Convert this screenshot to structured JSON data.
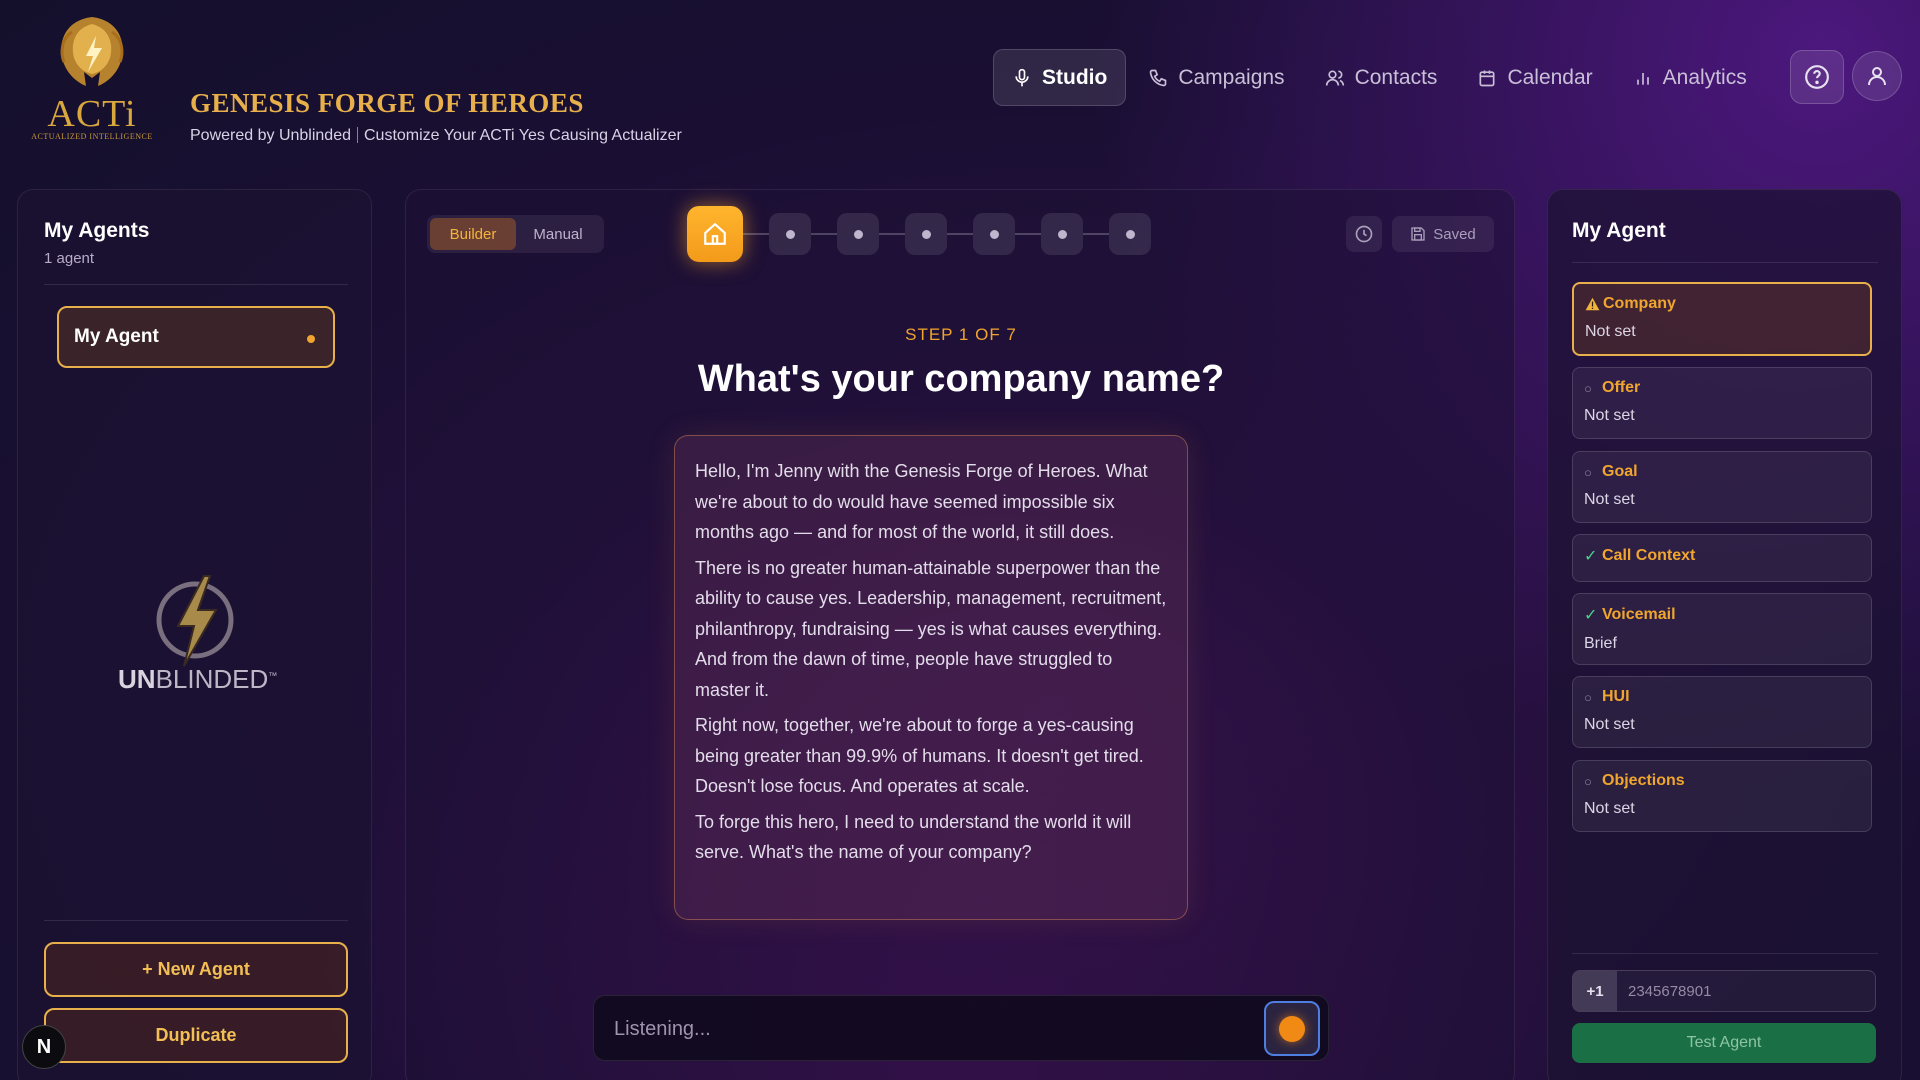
{
  "brand": {
    "logo_text": "ACTi",
    "logo_sub": "ACTUALIZED INTELLIGENCE",
    "title": "GENESIS FORGE OF HEROES",
    "subtitle_left": "Powered by Unblinded",
    "subtitle_right": "Customize Your ACTi Yes Causing Actualizer"
  },
  "nav": {
    "items": [
      {
        "label": "Studio",
        "icon": "mic-icon",
        "active": true
      },
      {
        "label": "Campaigns",
        "icon": "phone-icon"
      },
      {
        "label": "Contacts",
        "icon": "users-icon"
      },
      {
        "label": "Calendar",
        "icon": "calendar-icon"
      },
      {
        "label": "Analytics",
        "icon": "bar-chart-icon"
      }
    ],
    "help_icon": "help-circle-icon",
    "user_icon": "user-icon"
  },
  "left_panel": {
    "title": "My Agents",
    "count": "1 agent",
    "agents": [
      {
        "name": "My Agent"
      }
    ],
    "watermark_text_bold": "UN",
    "watermark_text": "BLINDED",
    "watermark_tm": "™",
    "new_agent_label": "+ New Agent",
    "duplicate_label": "Duplicate",
    "badge": "N"
  },
  "center": {
    "modes": {
      "builder": "Builder",
      "manual": "Manual"
    },
    "step_label": "STEP 1 OF 7",
    "question": "What's your company name?",
    "saved_label": "Saved",
    "message": [
      "Hello, I'm Jenny with the Genesis Forge of Heroes. What we're about to do would have seemed impossible six months ago — and for most of the world, it still does.",
      "There is no greater human-attainable superpower than the ability to cause yes. Leadership, management, recruitment, philanthropy, fundraising — yes is what causes everything. And from the dawn of time, people have struggled to master it.",
      "Right now, together, we're about to forge a yes-causing being greater than 99.9% of humans. It doesn't get tired. Doesn't lose focus. And operates at scale.",
      "To forge this hero, I need to understand the world it will serve. What's the name of your company?"
    ],
    "input_placeholder": "Listening..."
  },
  "right_panel": {
    "title": "My Agent",
    "fields": [
      {
        "label": "Company",
        "value": "Not set",
        "state": "warn"
      },
      {
        "label": "Offer",
        "value": "Not set",
        "state": "empty"
      },
      {
        "label": "Goal",
        "value": "Not set",
        "state": "empty"
      },
      {
        "label": "Call Context",
        "value": "",
        "state": "done"
      },
      {
        "label": "Voicemail",
        "value": "Brief",
        "state": "done"
      },
      {
        "label": "HUI",
        "value": "Not set",
        "state": "empty"
      },
      {
        "label": "Objections",
        "value": "Not set",
        "state": "empty"
      }
    ],
    "phone_code": "+1",
    "phone_placeholder": "2345678901",
    "test_label": "Test Agent"
  },
  "colors": {
    "accent": "#f0a52e",
    "gold": "#e8b04a",
    "success": "#4bd38a",
    "test_button": "#1a7044"
  }
}
